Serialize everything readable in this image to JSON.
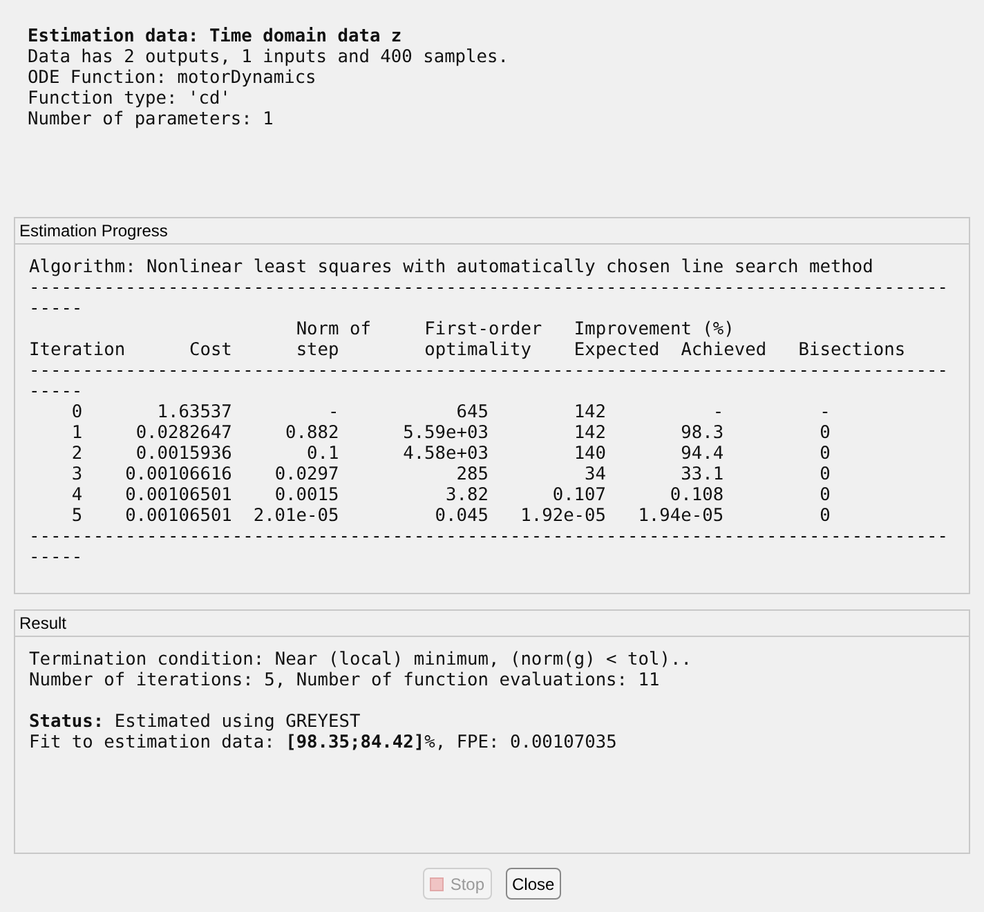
{
  "info": {
    "title": "Estimation data: Time domain data z",
    "lines": [
      "Data has 2 outputs, 1 inputs and 400 samples.",
      "ODE Function: motorDynamics",
      "Function type: 'cd'",
      "Number of parameters: 1"
    ]
  },
  "progress": {
    "title": "Estimation Progress",
    "algorithm": "Algorithm: Nonlinear least squares with automatically chosen line search method",
    "rule_top": "-------------------------------------------------------------------------------------------",
    "header_lines": [
      "                         Norm of     First-order   Improvement (%)",
      "Iteration      Cost      step        optimality    Expected  Achieved   Bisections"
    ],
    "rule_mid": "-------------------------------------------------------------------------------------------",
    "rows": [
      [
        "0",
        "1.63537",
        "-",
        "645",
        "142",
        "-",
        "-"
      ],
      [
        "1",
        "0.0282647",
        "0.882",
        "5.59e+03",
        "142",
        "98.3",
        "0"
      ],
      [
        "2",
        "0.0015936",
        "0.1",
        "4.58e+03",
        "140",
        "94.4",
        "0"
      ],
      [
        "3",
        "0.00106616",
        "0.0297",
        "285",
        "34",
        "33.1",
        "0"
      ],
      [
        "4",
        "0.00106501",
        "0.0015",
        "3.82",
        "0.107",
        "0.108",
        "0"
      ],
      [
        "5",
        "0.00106501",
        "2.01e-05",
        "0.045",
        "1.92e-05",
        "1.94e-05",
        "0"
      ]
    ],
    "rule_bottom": "-------------------------------------------------------------------------------------------"
  },
  "result": {
    "title": "Result",
    "paragraphs": [
      [
        "Termination condition: Near (local) minimum, (norm(g) < tol)..",
        "Number of iterations: 5, Number of function evaluations: 11"
      ],
      [
        "**Status:** Estimated using GREYEST",
        "Fit to estimation data: **[98.35;84.42]**%, FPE: 0.00107035"
      ]
    ]
  },
  "buttons": [
    {
      "label": "Stop",
      "disabled": true
    },
    {
      "label": "Close",
      "disabled": false
    }
  ]
}
